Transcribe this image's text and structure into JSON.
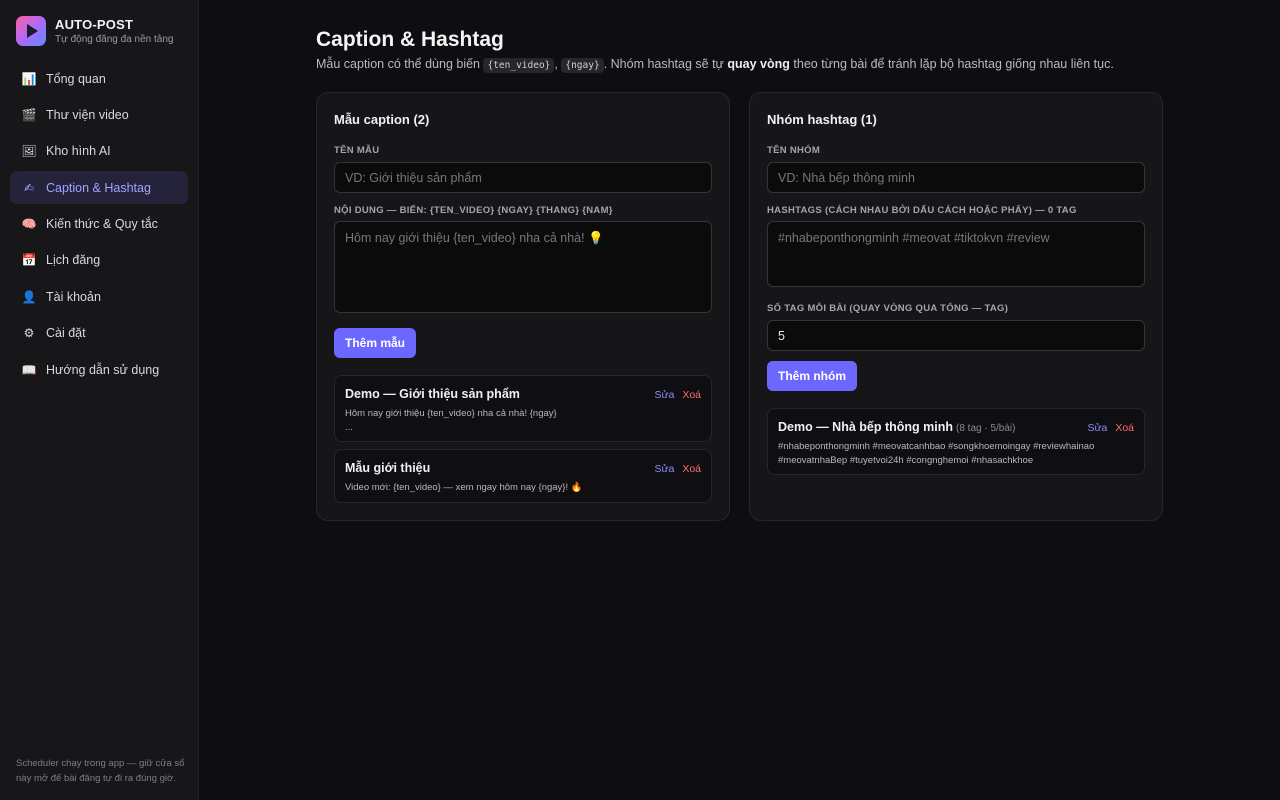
{
  "brand": {
    "title": "AUTO-POST",
    "subtitle": "Tự động đăng đa nền tảng"
  },
  "nav": {
    "items": [
      {
        "icon": "📊",
        "label": "Tổng quan"
      },
      {
        "icon": "🎬",
        "label": "Thư viện video"
      },
      {
        "icon": "🖼",
        "label": "Kho hình AI"
      },
      {
        "icon": "✍",
        "label": "Caption & Hashtag"
      },
      {
        "icon": "🧠",
        "label": "Kiến thức & Quy tắc"
      },
      {
        "icon": "📅",
        "label": "Lịch đăng"
      },
      {
        "icon": "👤",
        "label": "Tài khoản"
      },
      {
        "icon": "⚙",
        "label": "Cài đặt"
      },
      {
        "icon": "📖",
        "label": "Hướng dẫn sử dụng"
      }
    ],
    "active_index": 3
  },
  "sidebar_note": "Scheduler chạy trong app — giữ cửa sổ này mở để bài đăng tự đi ra đúng giờ.",
  "page": {
    "title": "Caption & Hashtag",
    "desc_1": "Mẫu caption có thể dùng biến ",
    "var_1": "{ten_video}",
    "desc_2": ", ",
    "var_2": "{ngay}",
    "desc_3": ". Nhóm hashtag sẽ tự ",
    "desc_bold": "quay vòng",
    "desc_4": " theo từng bài để tránh lặp bộ hashtag giống nhau liên tục."
  },
  "caption_card": {
    "title": "Mẫu caption (2)",
    "name_label": "TÊN MẪU",
    "name_placeholder": "VD: Giới thiệu sản phẩm",
    "content_label": "NỘI DUNG — BIẾN: {TEN_VIDEO} {NGAY} {THANG} {NAM}",
    "content_placeholder": "Hôm nay giới thiệu {ten_video} nha cả nhà! 💡",
    "add_button": "Thêm mẫu",
    "items": [
      {
        "title": "Demo — Giới thiệu sản phẩm",
        "body": "Hôm nay giới thiệu {ten_video} nha cả nhà! {ngay}\n...",
        "edit": "Sửa",
        "delete": "Xoá"
      },
      {
        "title": "Mẫu giới thiệu",
        "body": "Video mới: {ten_video} — xem ngay hôm nay {ngay}! 🔥",
        "edit": "Sửa",
        "delete": "Xoá"
      }
    ]
  },
  "hashtag_card": {
    "title": "Nhóm hashtag (1)",
    "name_label": "TÊN NHÓM",
    "name_placeholder": "VD: Nhà bếp thông minh",
    "tags_label": "HASHTAGS (CÁCH NHAU BỞI DẤU CÁCH HOẶC PHẨY) — 0 TAG",
    "tags_placeholder": "#nhabeponthongminh #meovat #tiktokvn #review",
    "count_label": "SỐ TAG MỖI BÀI (QUAY VÒNG QUA TỔNG — TAG)",
    "count_value": "5",
    "add_button": "Thêm nhóm",
    "items": [
      {
        "title": "Demo — Nhà bếp thông minh",
        "meta": "(8 tag · 5/bài)",
        "body": "#nhabeponthongminh #meovatcanhbao #songkhoemoingay #reviewhainao #meovatnhaBep #tuyetvoi24h #congnghemoi #nhasachkhoe",
        "edit": "Sửa",
        "delete": "Xoá"
      }
    ]
  },
  "colors": {
    "accent": "#6c67ff",
    "danger": "#ff6b6b",
    "bg": "#0e0e10",
    "card": "#161618"
  }
}
